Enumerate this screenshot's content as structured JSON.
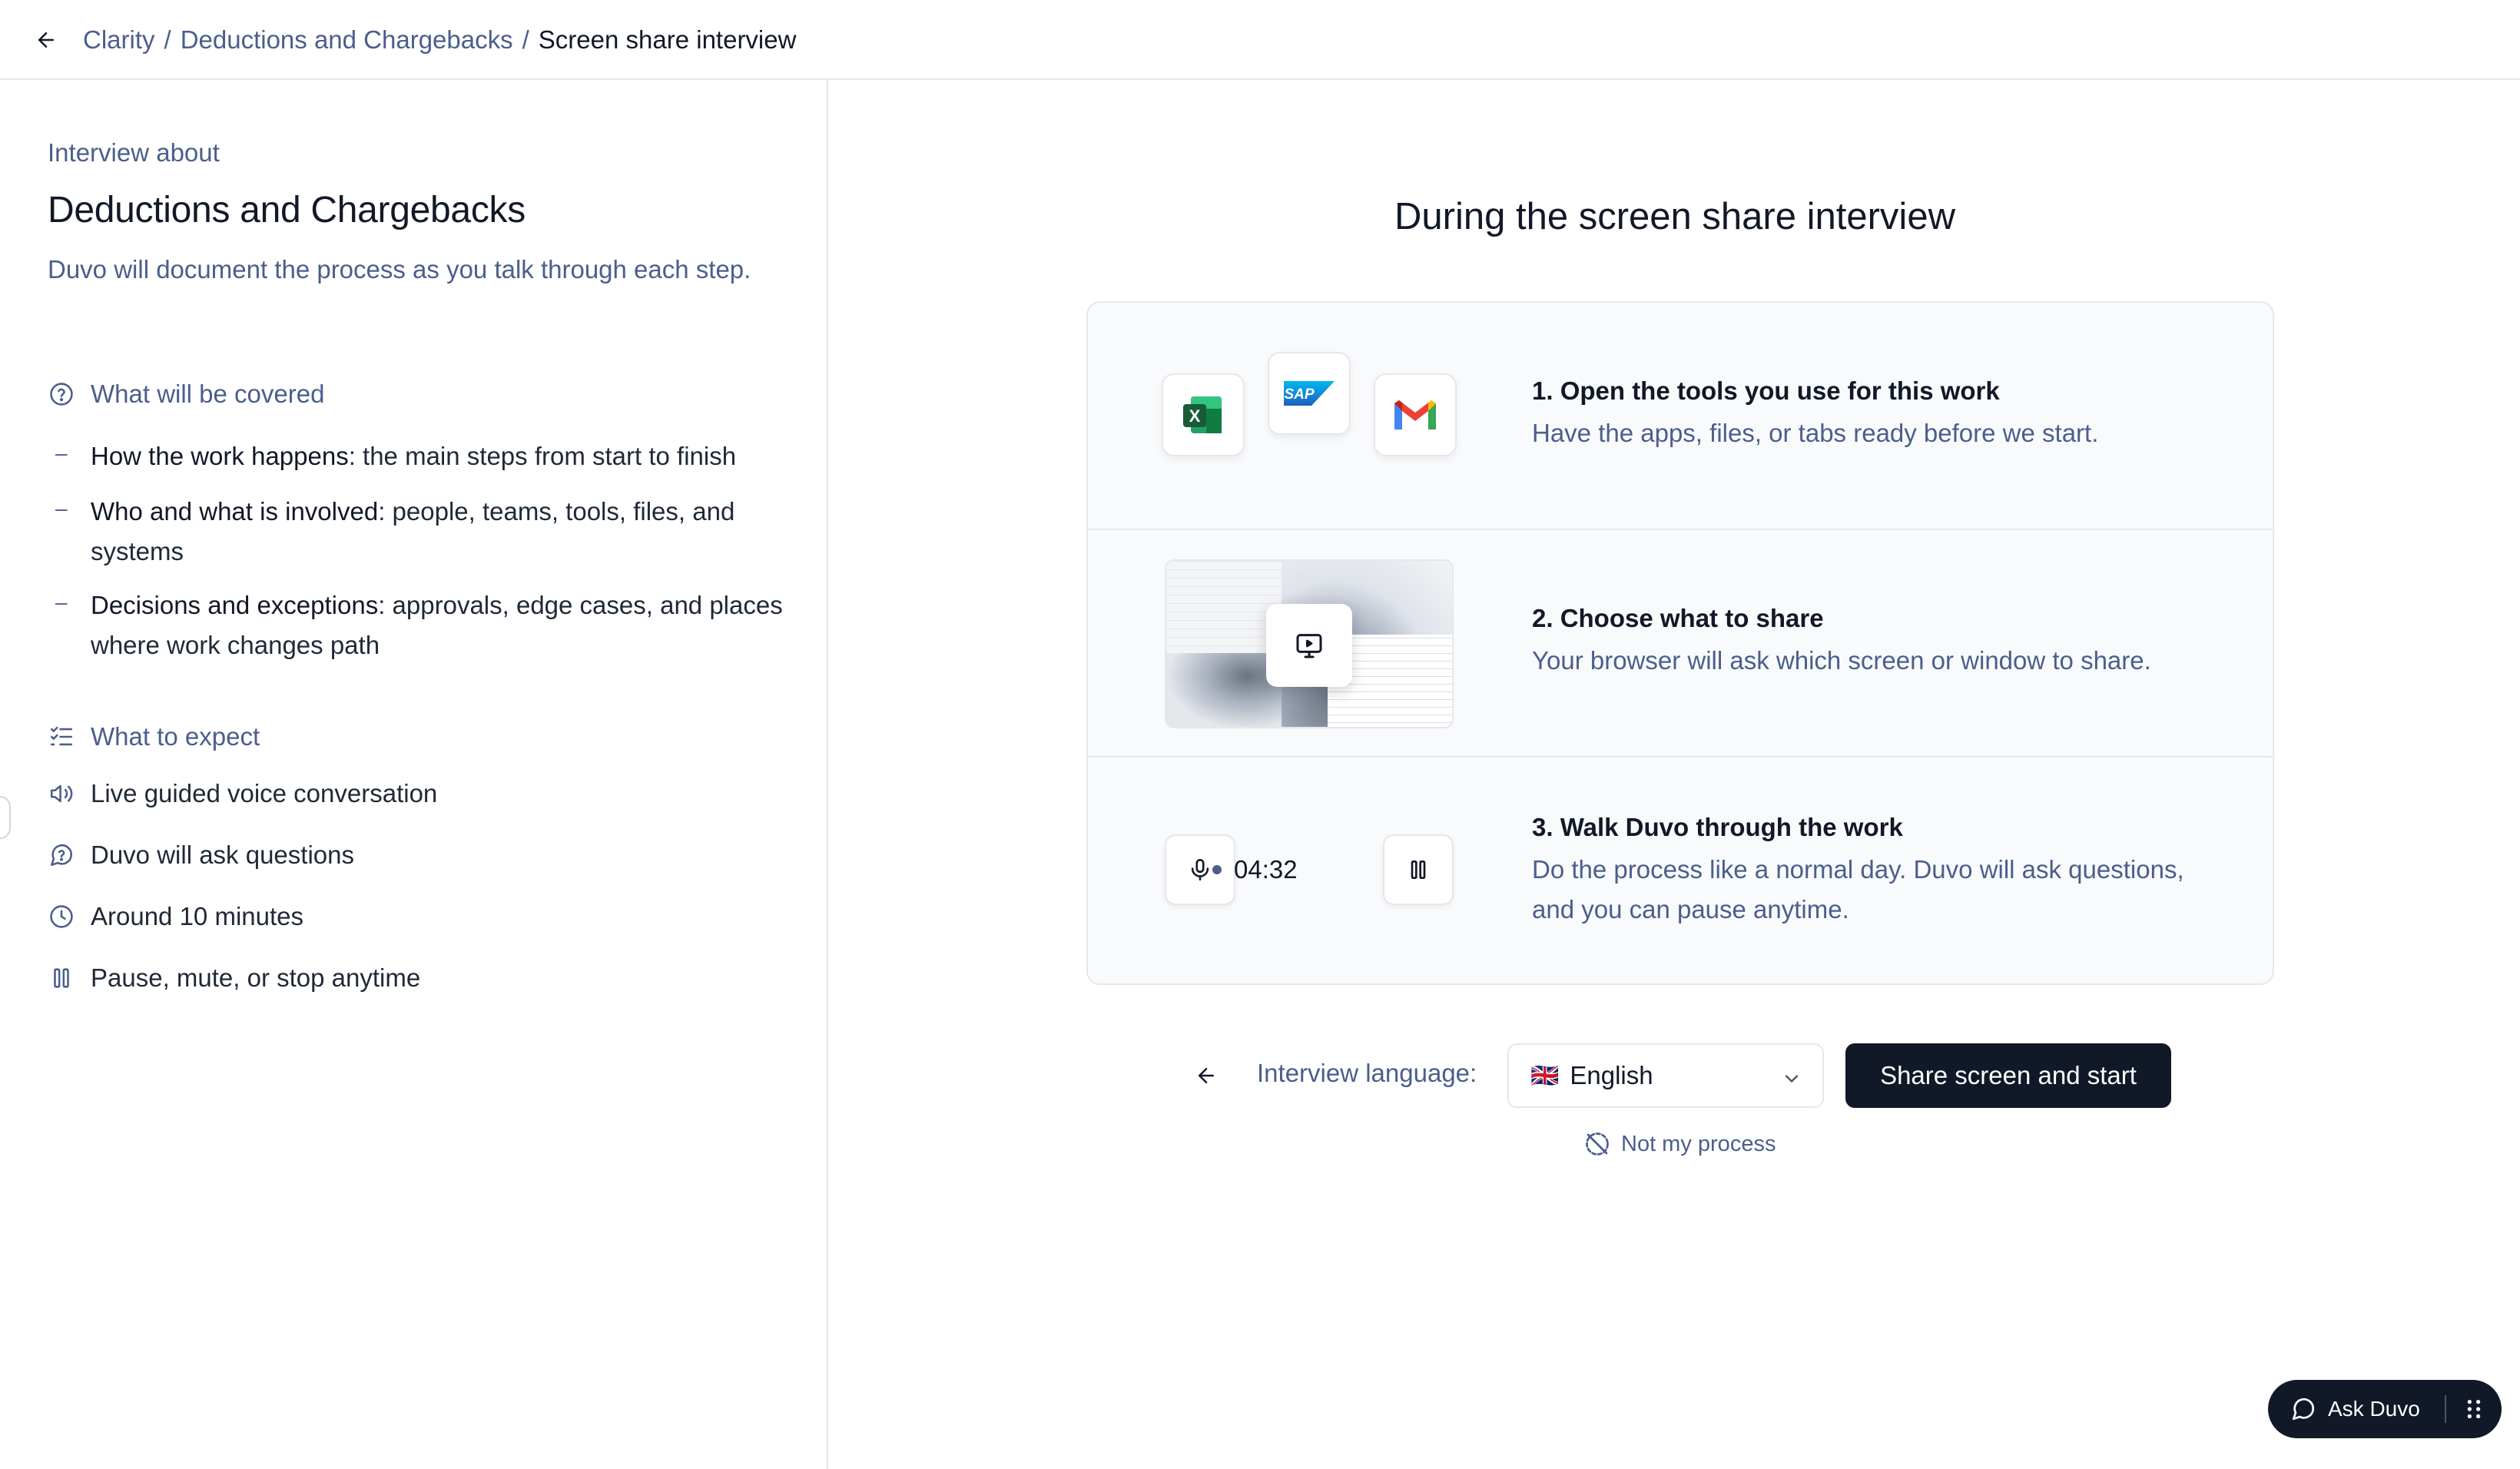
{
  "header": {
    "back_icon": "arrow-left-icon",
    "breadcrumb": [
      "Clarity",
      "Deductions and Chargebacks",
      "Screen share interview"
    ],
    "separator": "/"
  },
  "sidebar": {
    "eyebrow": "Interview about",
    "title": "Deductions and Chargebacks",
    "description": "Duvo will document the process as you talk through each step.",
    "covered_heading": "What will be covered",
    "covered_items": [
      {
        "bold": "How the work happens",
        "rest": ": the main steps from start to finish"
      },
      {
        "bold": "Who and what is involved",
        "rest": ": people, teams, tools, files, and systems"
      },
      {
        "bold": "Decisions and exceptions",
        "rest": ": approvals, edge cases, and places where work changes path"
      }
    ],
    "expect_heading": "What to expect",
    "expect_items": [
      {
        "label": "Live guided voice conversation",
        "icon": "speaker-icon"
      },
      {
        "label": "Duvo will ask questions",
        "icon": "question-bubble-icon"
      },
      {
        "label": "Around 10 minutes",
        "icon": "clock-icon"
      },
      {
        "label": "Pause, mute, or stop anytime",
        "icon": "pause-icon"
      }
    ]
  },
  "main": {
    "title": "During the screen share interview",
    "steps": [
      {
        "title": "1. Open the tools you use for this work",
        "desc": "Have the apps, files, or tabs ready before we start."
      },
      {
        "title": "2. Choose what to share",
        "desc": "Your browser will ask which screen or window to share."
      },
      {
        "title": "3. Walk Duvo through the work",
        "desc": "Do the process like a normal day. Duvo will ask questions, and you can pause anytime."
      }
    ],
    "apps": {
      "excel": "X",
      "sap": "SAP",
      "gmail": "M"
    },
    "timer": "04:32",
    "language_label": "Interview language:",
    "language_value": "English",
    "language_flag": "🇬🇧",
    "primary_button": "Share screen and start",
    "not_my_process": "Not my process"
  },
  "assistant": {
    "label": "Ask Duvo"
  },
  "colors": {
    "accent": "#111827",
    "muted": "#4b5e8c",
    "border": "#e5e7eb",
    "card_bg": "#f8fafc"
  }
}
